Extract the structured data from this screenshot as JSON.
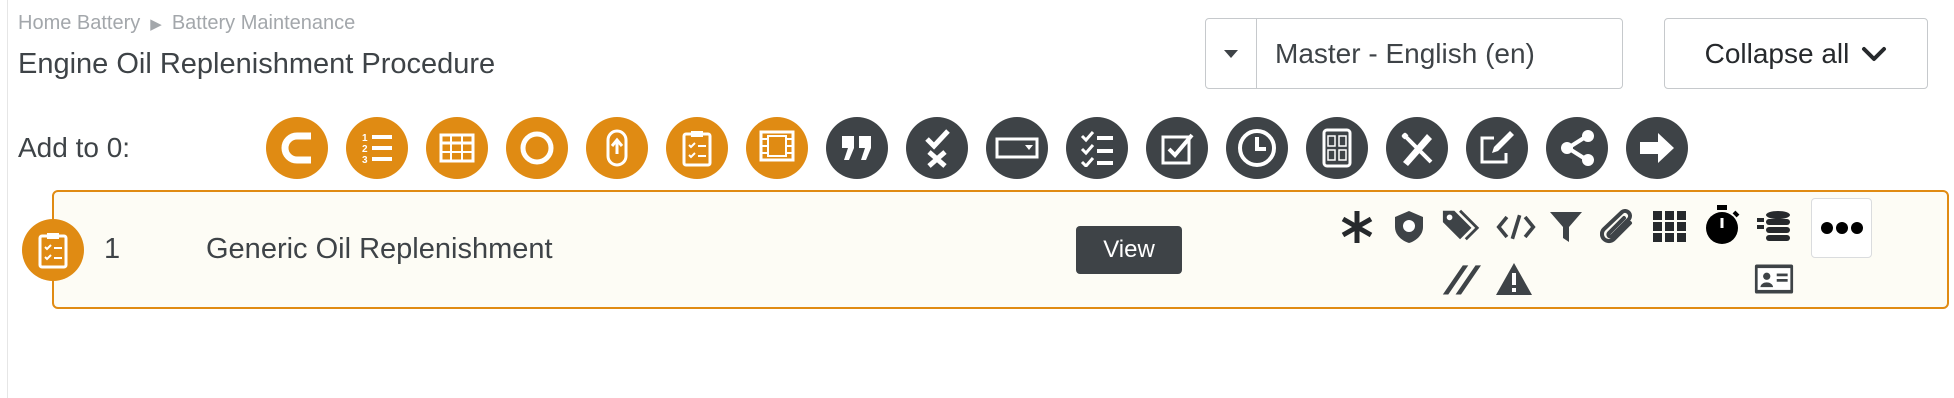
{
  "breadcrumb": {
    "items": [
      "Home Battery",
      "Battery Maintenance"
    ],
    "separator": "▶"
  },
  "page": {
    "title": "Engine Oil Replenishment Procedure"
  },
  "language_select": {
    "value": "Master - English (en)"
  },
  "collapse_button": {
    "label": "Collapse all"
  },
  "toolbar": {
    "label": "Add to 0:",
    "tools": [
      {
        "icon": "cable-icon",
        "color": "orange"
      },
      {
        "icon": "numbered-list-icon",
        "color": "orange"
      },
      {
        "icon": "table-icon",
        "color": "orange"
      },
      {
        "icon": "circle-icon",
        "color": "orange"
      },
      {
        "icon": "loop-icon",
        "color": "orange"
      },
      {
        "icon": "clipboard-checklist-icon",
        "color": "orange"
      },
      {
        "icon": "film-icon",
        "color": "orange"
      },
      {
        "icon": "quote-icon",
        "color": "dark"
      },
      {
        "icon": "check-cross-icon",
        "color": "dark"
      },
      {
        "icon": "dropdown-field-icon",
        "color": "dark"
      },
      {
        "icon": "checklist-icon",
        "color": "dark"
      },
      {
        "icon": "checkbox-icon",
        "color": "dark"
      },
      {
        "icon": "clock-icon",
        "color": "dark"
      },
      {
        "icon": "calculator-icon",
        "color": "dark"
      },
      {
        "icon": "pencil-ruler-icon",
        "color": "dark"
      },
      {
        "icon": "edit-icon",
        "color": "dark"
      },
      {
        "icon": "share-icon",
        "color": "dark"
      },
      {
        "icon": "arrow-right-icon",
        "color": "dark"
      }
    ]
  },
  "procedure_row": {
    "number": "1",
    "title": "Generic Oil Replenishment",
    "view_label": "View",
    "action_icons": [
      "asterisk-icon",
      "shield-icon",
      "tags-icon",
      "code-icon",
      "filter-icon",
      "paperclip-icon",
      "grid-icon",
      "stopwatch-icon",
      "database-icon",
      "more-icon",
      "slash-icon",
      "warning-icon",
      "id-card-icon"
    ]
  },
  "colors": {
    "accent": "#e08b13",
    "dark": "#3e4347",
    "row_bg": "#fdfcf5"
  }
}
